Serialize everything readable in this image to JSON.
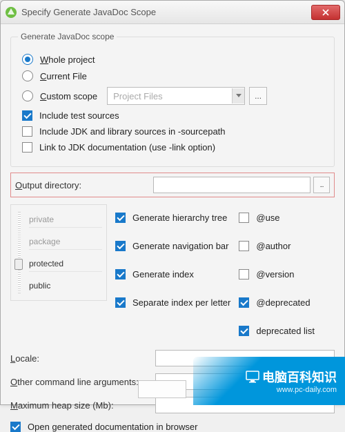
{
  "window": {
    "title": "Specify Generate JavaDoc Scope"
  },
  "group": {
    "title": "Generate JavaDoc scope"
  },
  "radios": {
    "whole_project": "Whole project",
    "current_file": "Current File",
    "custom_scope": "Custom scope"
  },
  "scope_dropdown": {
    "selected": "Project Files",
    "ellipsis": "..."
  },
  "checks": {
    "include_test": "Include test sources",
    "include_jdk": "Include JDK and library sources in -sourcepath",
    "link_jdk": "Link to JDK documentation (use -link option)",
    "open_browser": "Open generated documentation in browser"
  },
  "output": {
    "label": "Output directory:",
    "value": "",
    "browse": "..."
  },
  "slider": {
    "private": "private",
    "package": "package",
    "protected": "protected",
    "public": "public"
  },
  "gen_checks": {
    "hierarchy": "Generate hierarchy tree",
    "nav": "Generate navigation bar",
    "index": "Generate index",
    "sep_index": "Separate index per letter"
  },
  "tag_checks": {
    "use": "@use",
    "author": "@author",
    "version": "@version",
    "deprecated": "@deprecated",
    "deprecated_list": "deprecated list"
  },
  "fields": {
    "locale": "Locale:",
    "other_args": "Other command line arguments:",
    "heap": "Maximum heap size (Mb):"
  },
  "watermark": {
    "cn": "电脑百科知识",
    "url": "www.pc-daily.com"
  }
}
